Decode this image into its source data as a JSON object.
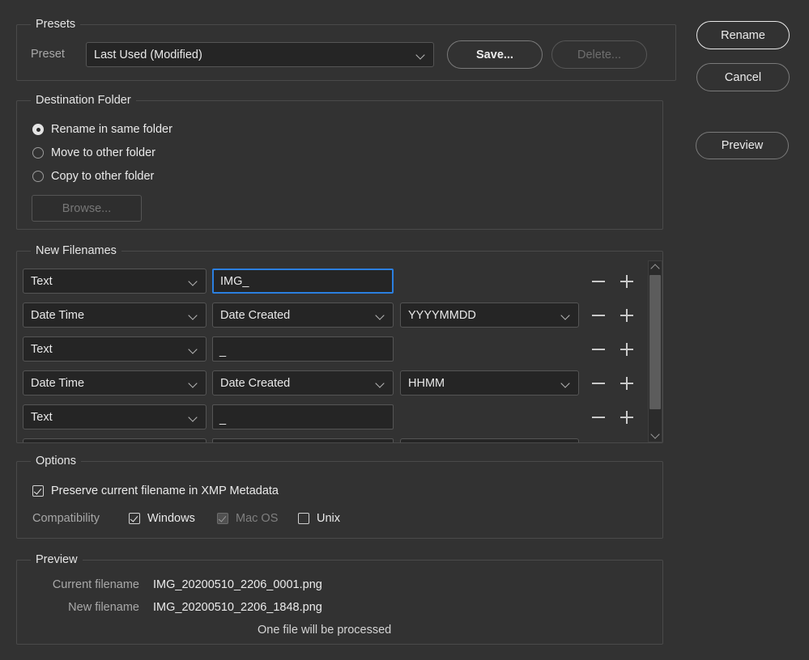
{
  "presets": {
    "group_title": "Presets",
    "preset_label": "Preset",
    "preset_value": "Last Used (Modified)",
    "save_label": "Save...",
    "delete_label": "Delete..."
  },
  "destination": {
    "group_title": "Destination Folder",
    "options": [
      {
        "label": "Rename in same folder",
        "checked": true
      },
      {
        "label": "Move to other folder",
        "checked": false
      },
      {
        "label": "Copy to other folder",
        "checked": false
      }
    ],
    "browse_label": "Browse..."
  },
  "new_filenames": {
    "group_title": "New Filenames",
    "rows": [
      {
        "type": "Text",
        "value": "IMG_",
        "focused": true,
        "format": null
      },
      {
        "type": "Date Time",
        "value": "Date Created",
        "focused": false,
        "format": "YYYYMMDD"
      },
      {
        "type": "Text",
        "value": "_",
        "focused": false,
        "format": null
      },
      {
        "type": "Date Time",
        "value": "Date Created",
        "focused": false,
        "format": "HHMM"
      },
      {
        "type": "Text",
        "value": "_",
        "focused": false,
        "format": null
      },
      {
        "type": "",
        "value": "",
        "focused": false,
        "format": ""
      }
    ],
    "minus_label": "minus",
    "plus_label": "plus"
  },
  "options": {
    "group_title": "Options",
    "preserve_label": "Preserve current filename in XMP Metadata",
    "preserve_checked": true,
    "compatibility_label": "Compatibility",
    "compat": [
      {
        "label": "Windows",
        "checked": true,
        "disabled": false
      },
      {
        "label": "Mac OS",
        "checked": true,
        "disabled": true
      },
      {
        "label": "Unix",
        "checked": false,
        "disabled": false
      }
    ]
  },
  "preview": {
    "group_title": "Preview",
    "current_label": "Current filename",
    "current_value": "IMG_20200510_2206_0001.png",
    "new_label": "New filename",
    "new_value": "IMG_20200510_2206_1848.png",
    "status": "One file will be processed"
  },
  "actions": {
    "rename_label": "Rename",
    "cancel_label": "Cancel",
    "preview_label": "Preview"
  },
  "colors": {
    "background": "#323232",
    "focus_blue": "#2b7fe0",
    "panel_border": "#4a4a4a"
  }
}
